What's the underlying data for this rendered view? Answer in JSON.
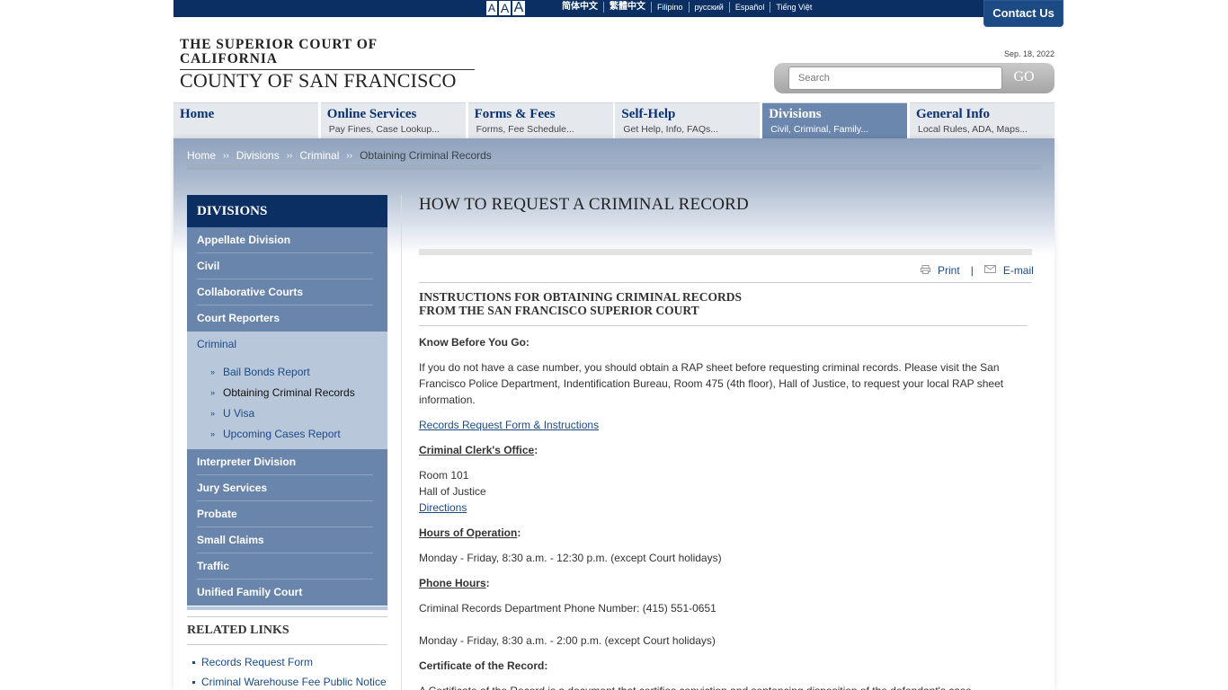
{
  "topbar": {
    "font_sizes": [
      "A",
      "A",
      "A"
    ],
    "languages": [
      "简体中文",
      "繁體中文",
      "Filipino",
      "русский",
      "Español",
      "Tiếng Việt"
    ],
    "contact_label": "Contact Us"
  },
  "header": {
    "logo_line1": "THE SUPERIOR COURT OF CALIFORNIA",
    "logo_line2": "COUNTY OF SAN FRANCISCO",
    "date": "Sep. 18, 2022",
    "search_placeholder": "Search",
    "search_button": "GO"
  },
  "nav": [
    {
      "title": "Home",
      "sub": ""
    },
    {
      "title": "Online Services",
      "sub": "Pay Fines, Case Lookup..."
    },
    {
      "title": "Forms & Fees",
      "sub": "Forms, Fee Schedule..."
    },
    {
      "title": "Self-Help",
      "sub": "Get Help, Info, FAQs..."
    },
    {
      "title": "Divisions",
      "sub": "Civil, Criminal, Family..."
    },
    {
      "title": "General Info",
      "sub": "Local Rules, ADA, Maps..."
    }
  ],
  "breadcrumb": {
    "items": [
      "Home",
      "Divisions",
      "Criminal"
    ],
    "sep": "››",
    "current": "Obtaining Criminal Records"
  },
  "sidebar": {
    "heading": "DIVISIONS",
    "items_top": [
      "Appellate Division",
      "Civil",
      "Collaborative Courts",
      "Court Reporters"
    ],
    "open_item": "Criminal",
    "sub_items": [
      "Bail Bonds Report",
      "Obtaining Criminal Records",
      "U Visa",
      "Upcoming Cases Report"
    ],
    "sub_bullet": "»",
    "items_bottom": [
      "Interpreter Division",
      "Jury Services",
      "Probate",
      "Small Claims",
      "Traffic",
      "Unified Family Court"
    ]
  },
  "related": {
    "heading": "RELATED LINKS",
    "items": [
      "Records Request Form",
      "Criminal Warehouse Fee Public Notice"
    ]
  },
  "main": {
    "title": "HOW TO REQUEST A CRIMINAL RECORD",
    "print_label": "Print",
    "pipe": "|",
    "email_label": "E-mail",
    "subtitle_line1": "INSTRUCTIONS FOR OBTAINING CRIMINAL RECORDS",
    "subtitle_line2": "FROM THE SAN FRANCISCO SUPERIOR COURT",
    "know_before": "Know Before You Go:",
    "intro": "If you do not have a case number, you should obtain a RAP sheet before requesting criminal records. Please visit the San Francisco Police Department, Indentification Bureau, Room 475 (4th floor), Hall of Justice, to request your local RAP sheet information.",
    "records_link": "Records Request Form & Instructions",
    "clerk_heading": "Criminal Clerk's Office",
    "room": "Room 101",
    "hall": "Hall of Justice",
    "directions": "Directions",
    "hours_heading": "Hours of Operation",
    "hours": "Monday - Friday, 8:30 a.m. - 12:30 p.m. (except Court holidays)",
    "phone_heading": "Phone Hours",
    "phone_number": "Criminal Records Department Phone Number: (415) 551-0651",
    "phone_hours": "Monday - Friday, 8:30 a.m. - 2:00 p.m. (except Court holidays)",
    "cert_heading": "Certificate of the Record:",
    "cert_text": "A Certificate of the Record is a document that certifies conviction and sentencing disposition of the defendant's case."
  },
  "colors": {
    "topbar": "#0b2f62",
    "nav_active": "#6c87ae",
    "sidebar": "#6a85ab",
    "link": "#1b4a85"
  }
}
